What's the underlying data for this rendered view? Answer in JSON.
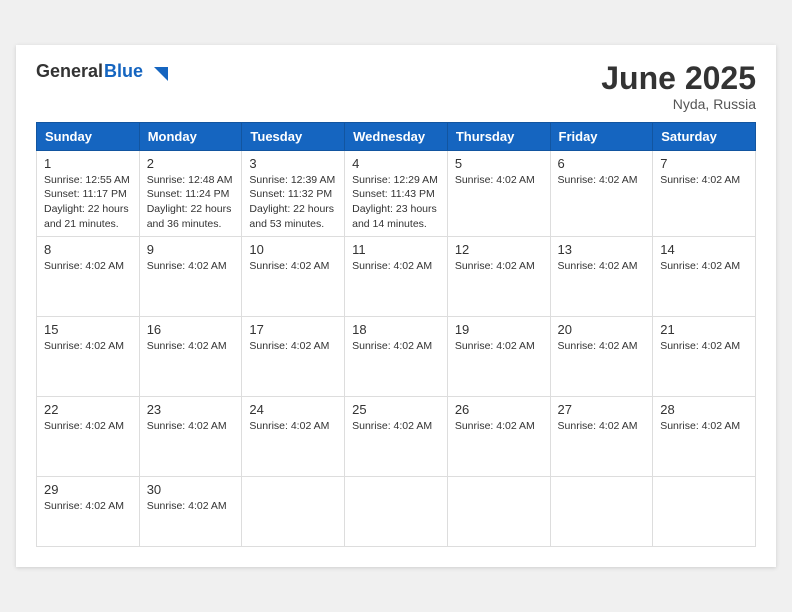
{
  "header": {
    "logo_line1": "General",
    "logo_line2": "Blue",
    "month_year": "June 2025",
    "location": "Nyda, Russia"
  },
  "weekdays": [
    "Sunday",
    "Monday",
    "Tuesday",
    "Wednesday",
    "Thursday",
    "Friday",
    "Saturday"
  ],
  "weeks": [
    [
      {
        "day": "1",
        "info": "Sunrise: 12:55 AM\nSunset: 11:17 PM\nDaylight: 22 hours and 21 minutes."
      },
      {
        "day": "2",
        "info": "Sunrise: 12:48 AM\nSunset: 11:24 PM\nDaylight: 22 hours and 36 minutes."
      },
      {
        "day": "3",
        "info": "Sunrise: 12:39 AM\nSunset: 11:32 PM\nDaylight: 22 hours and 53 minutes."
      },
      {
        "day": "4",
        "info": "Sunrise: 12:29 AM\nSunset: 11:43 PM\nDaylight: 23 hours and 14 minutes."
      },
      {
        "day": "5",
        "info": "Sunrise: 4:02 AM"
      },
      {
        "day": "6",
        "info": "Sunrise: 4:02 AM"
      },
      {
        "day": "7",
        "info": "Sunrise: 4:02 AM"
      }
    ],
    [
      {
        "day": "8",
        "info": "Sunrise: 4:02 AM"
      },
      {
        "day": "9",
        "info": "Sunrise: 4:02 AM"
      },
      {
        "day": "10",
        "info": "Sunrise: 4:02 AM"
      },
      {
        "day": "11",
        "info": "Sunrise: 4:02 AM"
      },
      {
        "day": "12",
        "info": "Sunrise: 4:02 AM"
      },
      {
        "day": "13",
        "info": "Sunrise: 4:02 AM"
      },
      {
        "day": "14",
        "info": "Sunrise: 4:02 AM"
      }
    ],
    [
      {
        "day": "15",
        "info": "Sunrise: 4:02 AM"
      },
      {
        "day": "16",
        "info": "Sunrise: 4:02 AM"
      },
      {
        "day": "17",
        "info": "Sunrise: 4:02 AM"
      },
      {
        "day": "18",
        "info": "Sunrise: 4:02 AM"
      },
      {
        "day": "19",
        "info": "Sunrise: 4:02 AM"
      },
      {
        "day": "20",
        "info": "Sunrise: 4:02 AM"
      },
      {
        "day": "21",
        "info": "Sunrise: 4:02 AM"
      }
    ],
    [
      {
        "day": "22",
        "info": "Sunrise: 4:02 AM"
      },
      {
        "day": "23",
        "info": "Sunrise: 4:02 AM"
      },
      {
        "day": "24",
        "info": "Sunrise: 4:02 AM"
      },
      {
        "day": "25",
        "info": "Sunrise: 4:02 AM"
      },
      {
        "day": "26",
        "info": "Sunrise: 4:02 AM"
      },
      {
        "day": "27",
        "info": "Sunrise: 4:02 AM"
      },
      {
        "day": "28",
        "info": "Sunrise: 4:02 AM"
      }
    ],
    [
      {
        "day": "29",
        "info": "Sunrise: 4:02 AM"
      },
      {
        "day": "30",
        "info": "Sunrise: 4:02 AM"
      },
      {
        "day": "",
        "info": ""
      },
      {
        "day": "",
        "info": ""
      },
      {
        "day": "",
        "info": ""
      },
      {
        "day": "",
        "info": ""
      },
      {
        "day": "",
        "info": ""
      }
    ]
  ]
}
